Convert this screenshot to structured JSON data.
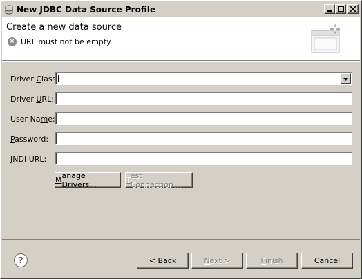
{
  "window": {
    "title": "New JDBC Data Source Profile",
    "controls": {
      "minimize": "_",
      "maximize": "□",
      "close": "×"
    }
  },
  "header": {
    "title": "Create a new data source",
    "error_icon": "x-circle-icon",
    "error_icon_glyph": "×",
    "message": "URL must not be empty."
  },
  "form": {
    "driver_class": {
      "label_pre": "Driver ",
      "label_key": "C",
      "label_post": "lass:",
      "value": ""
    },
    "driver_url": {
      "label_pre": "Driver ",
      "label_key": "U",
      "label_post": "RL:",
      "value": ""
    },
    "user_name": {
      "label_pre": "User Na",
      "label_key": "m",
      "label_post": "e:",
      "value": ""
    },
    "password": {
      "label_pre": "",
      "label_key": "P",
      "label_post": "assword:",
      "value": ""
    },
    "jndi_url": {
      "label_pre": "",
      "label_key": "J",
      "label_post": "NDI URL:",
      "value": ""
    }
  },
  "buttons": {
    "manage_drivers": {
      "key": "M",
      "rest": "anage Drivers..."
    },
    "test_connection": {
      "key": "T",
      "rest": "est Connection..."
    },
    "back": {
      "prefix": "< ",
      "key": "B",
      "rest": "ack"
    },
    "next": {
      "key": "N",
      "rest": "ext >"
    },
    "finish": {
      "key": "F",
      "rest": "inish"
    },
    "cancel": "Cancel"
  },
  "help": {
    "glyph": "?"
  }
}
